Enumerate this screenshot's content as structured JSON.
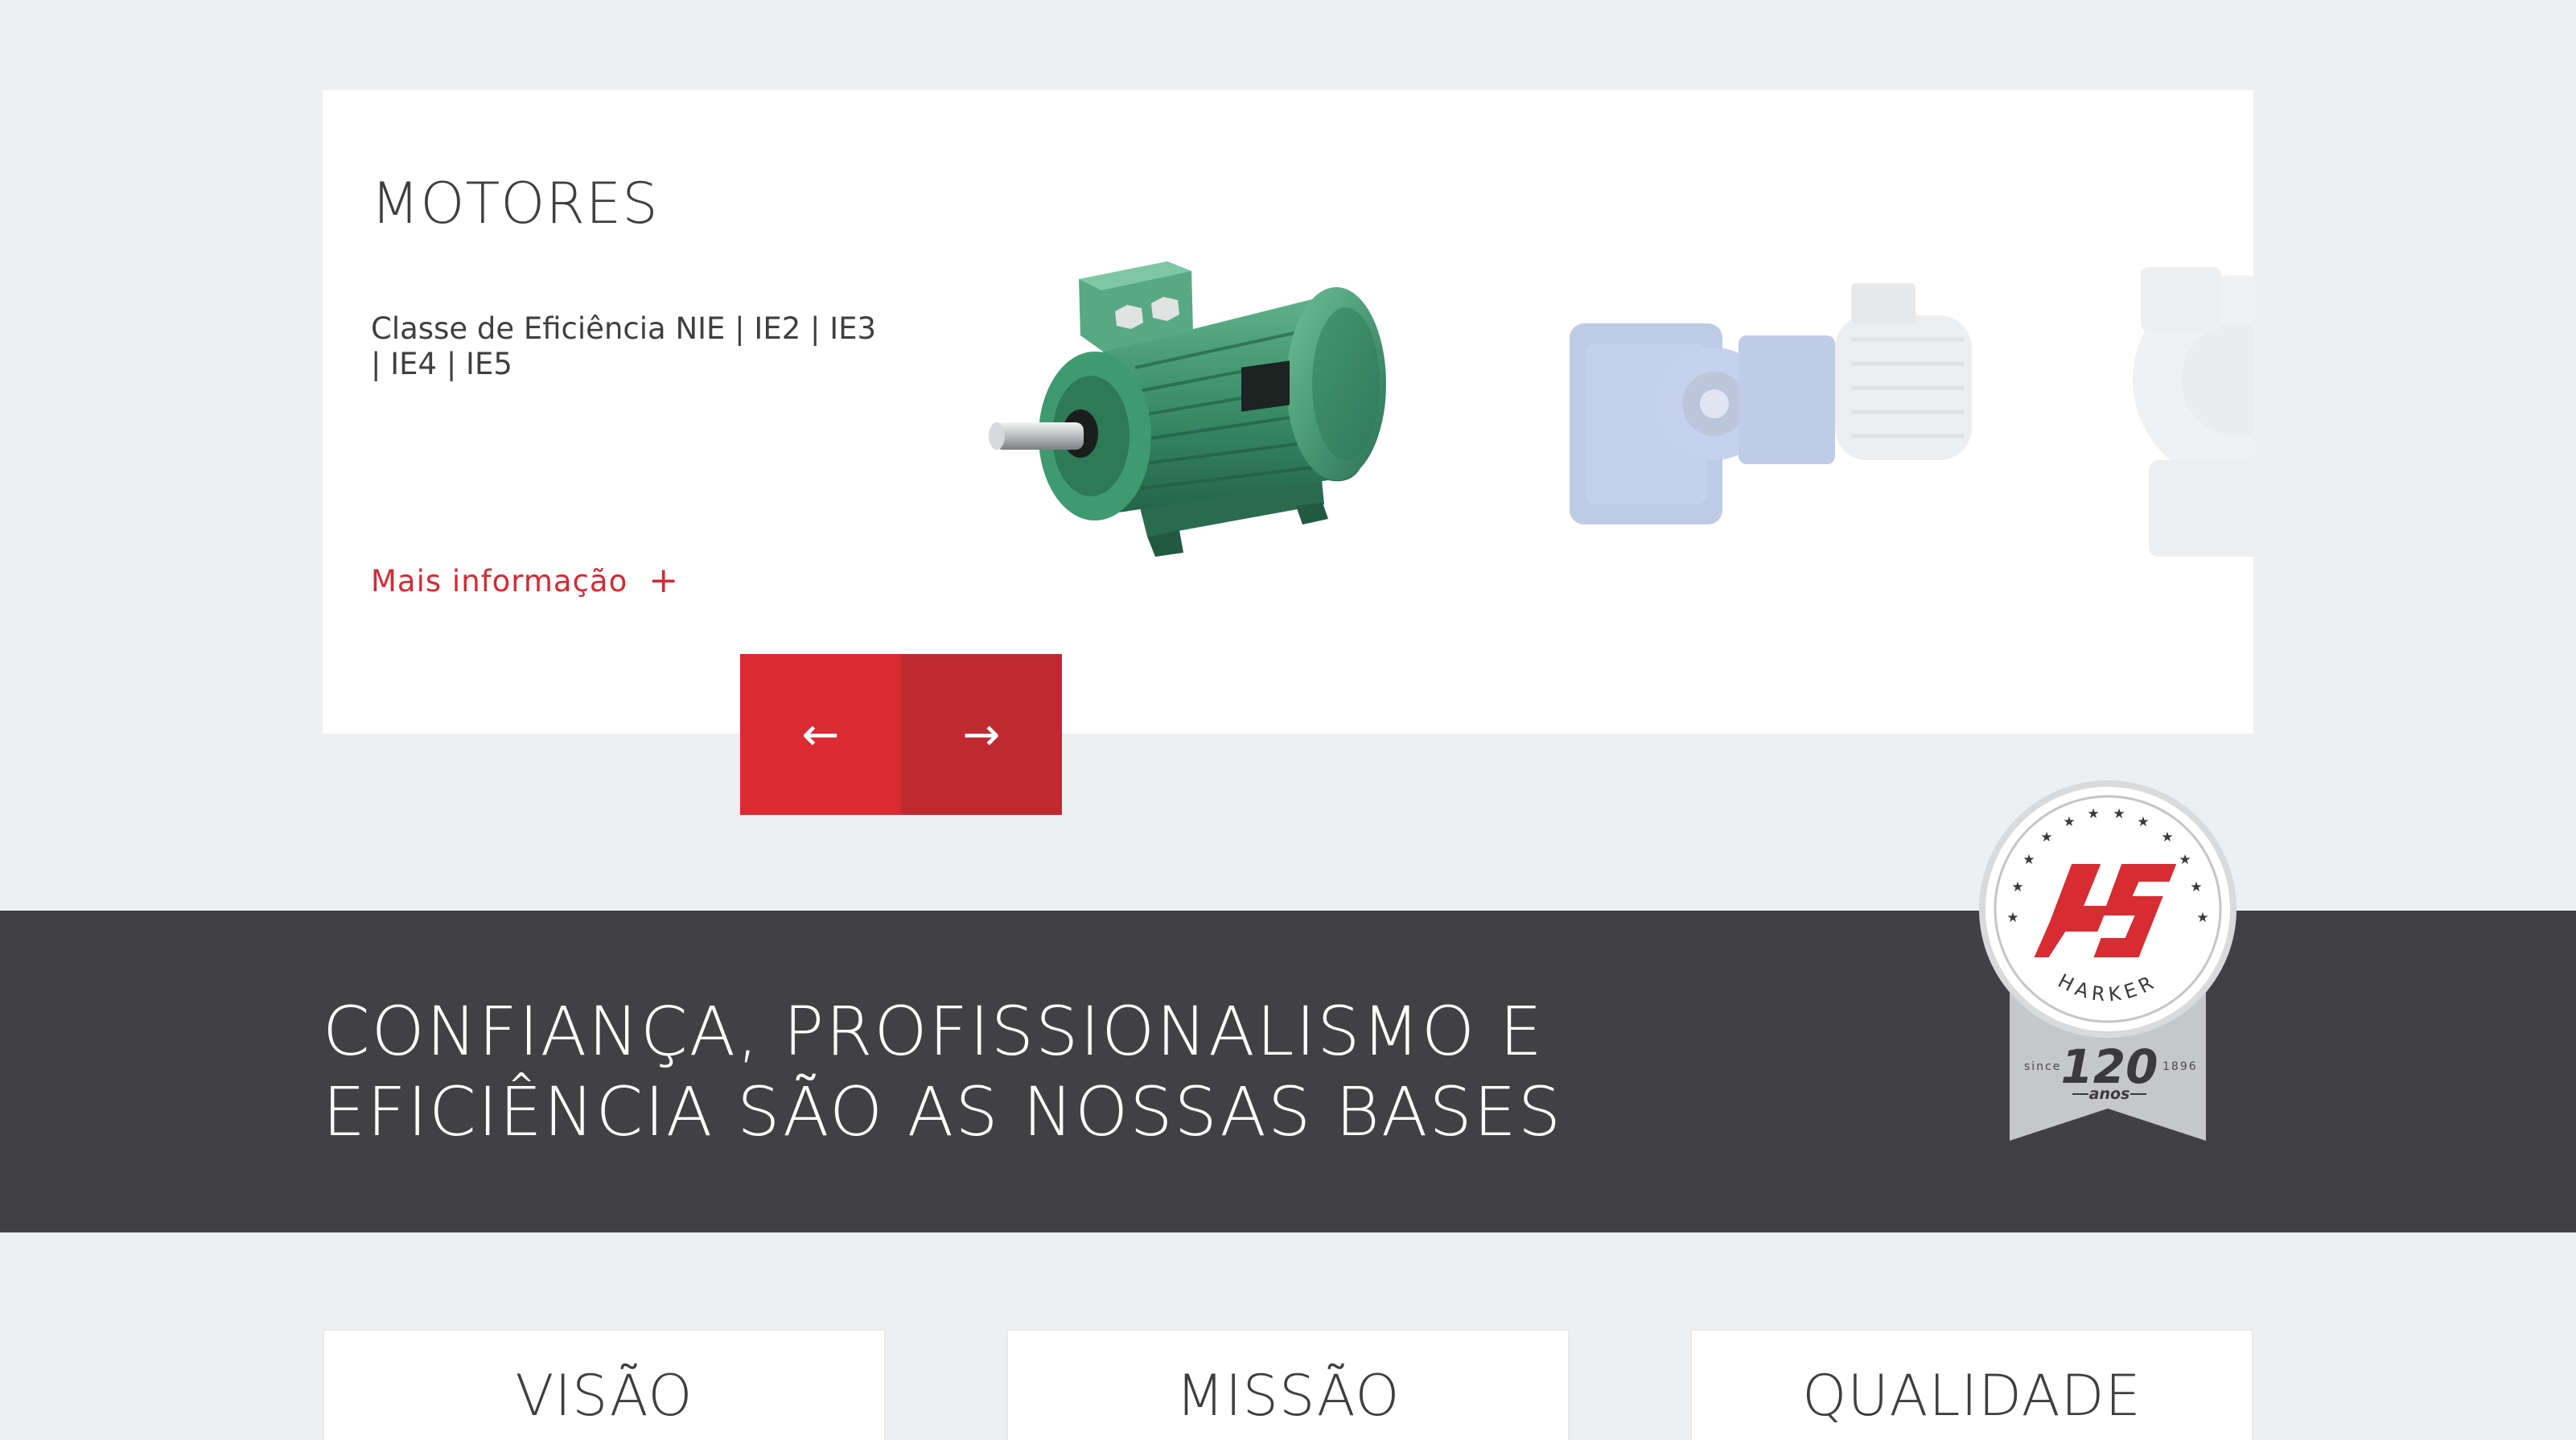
{
  "product_card": {
    "title": "MOTORES",
    "description": "Classe de Eficiência   NIE | IE2 | IE3 | IE4 | IE5",
    "more_label": "Mais informação",
    "more_icon": "plus-icon",
    "prev_icon": "arrow-left-icon",
    "next_icon": "arrow-right-icon"
  },
  "band": {
    "title": "CONFIANÇA, PROFISSIONALISMO E EFICIÊNCIA SÃO AS NOSSAS BASES"
  },
  "seal": {
    "brand": "HARKER",
    "since_label": "since",
    "year": "1896",
    "number": "120",
    "unit": "anos"
  },
  "values": [
    {
      "title": "VISÃO"
    },
    {
      "title": "MISSÃO"
    },
    {
      "title": "QUALIDADE"
    }
  ],
  "colors": {
    "page_bg": "#eeeff1",
    "card_bg": "#ffffff",
    "accent_red": "#d92b31",
    "accent_red_dark": "#bf2a31",
    "band_bg": "#414143",
    "text_dark": "#3f3f42",
    "motor_green": "#3a8f68"
  }
}
